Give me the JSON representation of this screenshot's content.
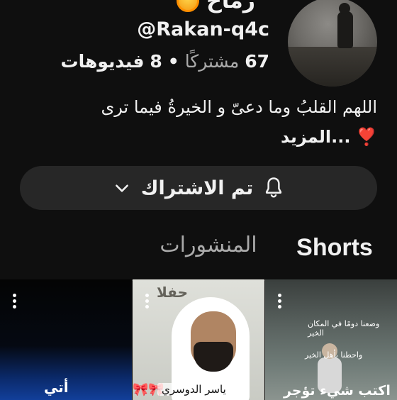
{
  "channel": {
    "name": "رماح",
    "handle": "@Rakan-q4c",
    "subscriber_count": "67",
    "subscriber_label": "مشتركًا",
    "separator": "•",
    "video_count": "8",
    "video_label": "فيديوهات",
    "bio_text": "اللهم القلبُ وما دعىّ و الخيرةُ فيما ترى",
    "bio_emoji": "❣️",
    "bio_more": "...المزيد"
  },
  "subscribe": {
    "label": "تم الاشتراك",
    "bell_icon": "bell-icon",
    "chevron_icon": "chevron-down-icon"
  },
  "tabs": [
    {
      "label": "Shorts",
      "selected": true
    },
    {
      "label": "المنشورات",
      "selected": false
    }
  ],
  "shorts": [
    {
      "caption": "أتي"
    },
    {
      "sign": "حفلا",
      "caption": "ياسر الدوسري",
      "bows": "🎀🎀"
    },
    {
      "line1": "وضعنا دومًا في المكان الخير",
      "line2": "واحطنا بأهل الخير",
      "caption": "اكتب شيء تؤجر عليه"
    }
  ],
  "colors": {
    "background": "#0f0f0f",
    "button_bg": "#272727",
    "text_primary": "#f1f1f1",
    "text_secondary": "#aaaaaa"
  }
}
